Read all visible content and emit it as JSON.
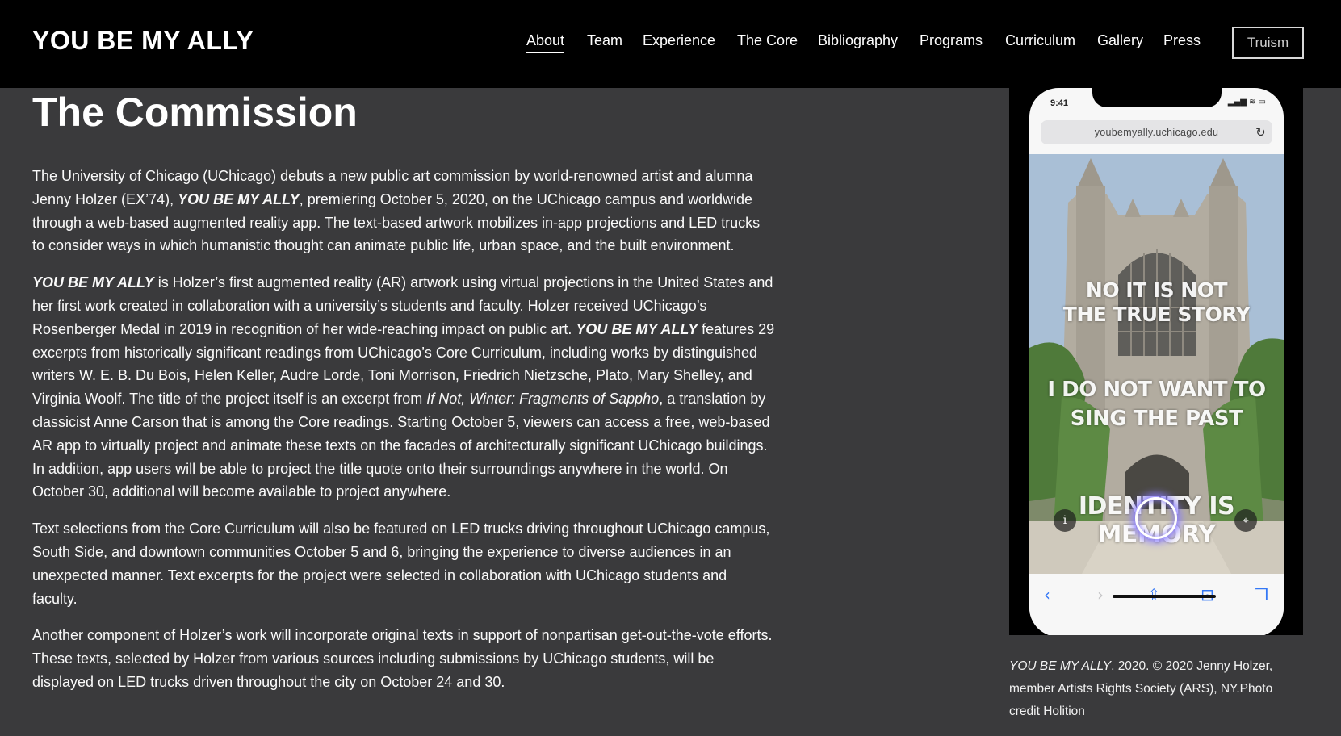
{
  "header": {
    "site_title": "YOU BE MY ALLY",
    "nav": [
      "About",
      "Team",
      "Experience",
      "The Core",
      "Bibliography",
      "Programs",
      "Curriculum",
      "Gallery",
      "Press"
    ],
    "active_nav": "About",
    "truism_label": "Truism"
  },
  "main": {
    "page_title": "The Commission",
    "paragraphs": {
      "p1": {
        "a": "The University of Chicago (UChicago) debuts a new public art commission by world-renowned artist and alumna Jenny Holzer (EX’74), ",
        "em": "YOU BE MY ALLY",
        "b": ", premiering October 5, 2020, on the UChicago campus and worldwide through a web-based augmented reality app. The text-based artwork mobilizes in-app projections and LED trucks to consider ways in which humanistic thought can animate public life, urban space, and the built environment."
      },
      "p2": {
        "em1": "YOU BE MY ALLY",
        "a": " is Holzer’s first augmented reality (AR) artwork using virtual projections in the United States and her first work created in collaboration with a university’s students and faculty.  Holzer received UChicago’s Rosenberger Medal in 2019 in recognition of her wide-reaching impact on public art. ",
        "em2": "YOU BE MY ALLY",
        "b": " features 29 excerpts from historically significant readings from UChicago’s Core Curriculum, including works by distinguished writers W. E. B. Du Bois, Helen Keller, Audre Lorde, Toni Morrison, Friedrich Nietzsche, Plato, Mary Shelley, and Virginia Woolf. The title of the project itself is an excerpt from ",
        "book": "If Not, Winter: Fragments of Sappho",
        "c": ", a translation by classicist Anne Carson that is among the Core readings. Starting October 5, viewers can access a free, web-based AR app to virtually project and animate these texts on the facades of architecturally significant UChicago buildings.  In addition, app users will be able to project the title quote onto their surroundings anywhere in the world. On October 30, additional will become available to project anywhere."
      },
      "p3": "Text selections from the Core Curriculum will also be featured on LED trucks driving throughout UChicago campus, South Side, and downtown communities October 5 and 6, bringing the experience to diverse audiences in an unexpected manner. Text excerpts for the project were selected in collaboration with UChicago students and faculty.",
      "p4": "Another component of Holzer’s work will incorporate original texts in support of nonpartisan get-out-the-vote efforts. These texts, selected by Holzer from various sources including submissions by UChicago students, will be displayed on LED trucks driven throughout the city on October 24 and 30."
    }
  },
  "figure": {
    "status_time": "9:41",
    "url": "youbemyally.uchicago.edu",
    "ar_lines": [
      "NO IT IS NOT",
      "THE TRUE STORY",
      "I DO NOT WANT TO",
      "SING THE PAST",
      "IDENTITY IS MEMORY"
    ],
    "info_glyph": "i",
    "icons": {
      "reload": "reload-icon",
      "info": "info-icon",
      "pin": "location-pin-icon",
      "back": "back-icon",
      "forward": "forward-icon",
      "share": "share-icon",
      "bookmarks": "bookmarks-icon",
      "tabs": "tabs-icon"
    },
    "caption_em": "YOU BE MY ALLY",
    "caption_rest": ", 2020. © 2020 Jenny Holzer, member Artists Rights Society (ARS), NY.Photo credit Holition"
  },
  "colors": {
    "header_bg": "#000000",
    "page_bg": "#3a3a3c",
    "text": "#ffffff",
    "ios_blue": "#3478f6",
    "ar_glow": "#8a7dff"
  }
}
